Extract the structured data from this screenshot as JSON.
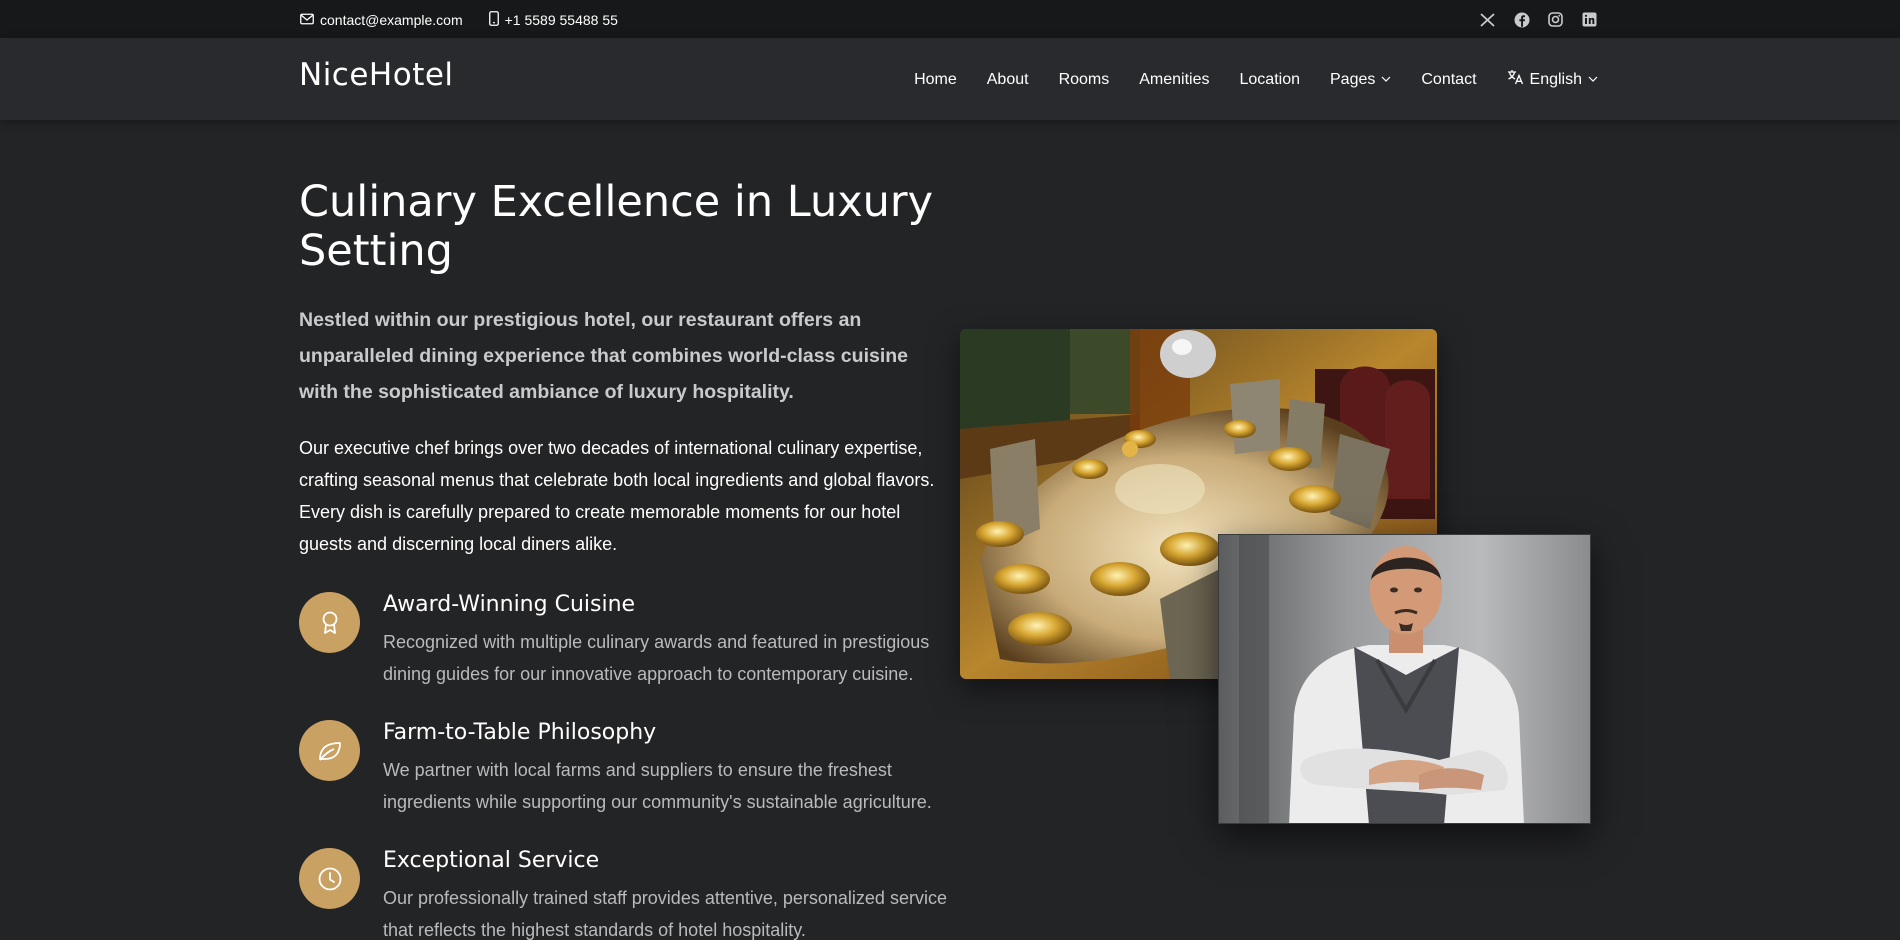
{
  "topbar": {
    "email": "contact@example.com",
    "phone": "+1 5589 55488 55",
    "social": [
      "x-icon",
      "facebook-icon",
      "instagram-icon",
      "linkedin-icon"
    ]
  },
  "header": {
    "logo": "NiceHotel",
    "nav": {
      "home": "Home",
      "about": "About",
      "rooms": "Rooms",
      "amenities": "Amenities",
      "location": "Location",
      "pages": "Pages",
      "contact": "Contact",
      "language": "English"
    }
  },
  "main": {
    "title": "Culinary Excellence in Luxury Setting",
    "lead": "Nestled within our prestigious hotel, our restaurant offers an unparalleled dining experience that combines world-class cuisine with the sophisticated ambiance of luxury hospitality.",
    "body": "Our executive chef brings over two decades of international culinary expertise, crafting seasonal menus that celebrate both local ingredients and global flavors. Every dish is carefully prepared to create memorable moments for our hotel guests and discerning local diners alike.",
    "features": [
      {
        "icon": "award-icon",
        "title": "Award-Winning Cuisine",
        "text": "Recognized with multiple culinary awards and featured in prestigious dining guides for our innovative approach to contemporary cuisine."
      },
      {
        "icon": "leaf-icon",
        "title": "Farm-to-Table Philosophy",
        "text": "We partner with local farms and suppliers to ensure the freshest ingredients while supporting our community's sustainable agriculture."
      },
      {
        "icon": "clock-icon",
        "title": "Exceptional Service",
        "text": "Our professionally trained staff provides attentive, personalized service that reflects the highest standards of hotel hospitality."
      }
    ]
  },
  "colors": {
    "accent": "#c9a162",
    "background": "#232426",
    "header": "#282a2d",
    "topbar": "#16181a"
  }
}
